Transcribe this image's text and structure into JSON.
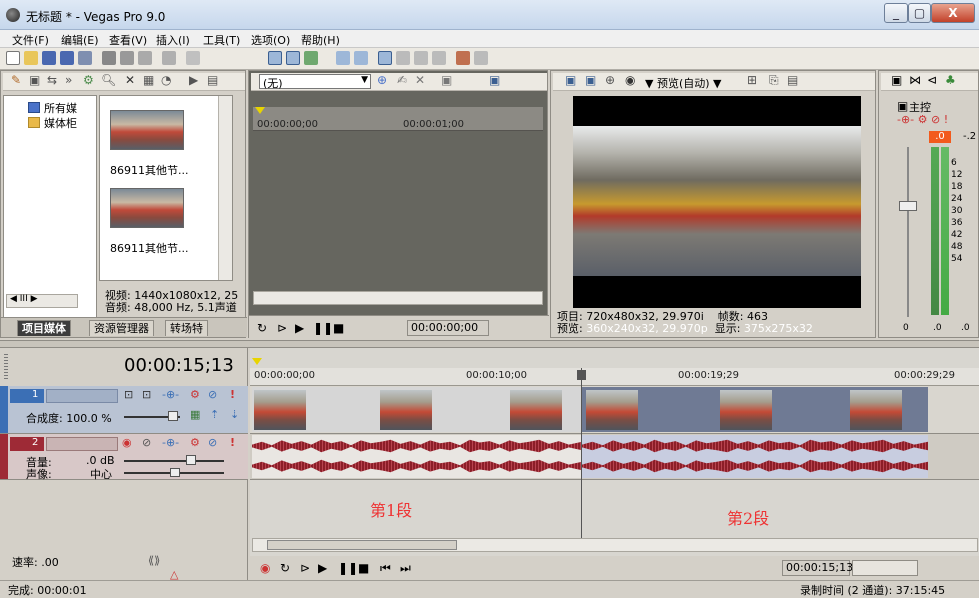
{
  "window": {
    "title": "无标题 * - Vegas Pro 9.0",
    "minimize": "_",
    "maximize": "▢",
    "close": "X"
  },
  "menu": [
    "文件(F)",
    "编辑(E)",
    "查看(V)",
    "插入(I)",
    "工具(T)",
    "选项(O)",
    "帮助(H)"
  ],
  "media": {
    "tree": [
      "所有媒",
      "媒体柜"
    ],
    "items": [
      {
        "caption": "86911其他节..."
      },
      {
        "caption": "86911其他节..."
      }
    ],
    "info_video": "视频: 1440x1080x12, 25",
    "info_audio": "音频: 48,000 Hz, 5.1声道",
    "tabs": [
      "项目媒体",
      "资源管理器",
      "转场特"
    ]
  },
  "trimmer": {
    "dropdown": "(无)",
    "ruler_start": "00:00:00;00",
    "ruler_mid": "00:00:01;00",
    "timecode": "00:00:00;00"
  },
  "preview": {
    "mode": "预览(自动)",
    "project": "项目: 720x480x32, 29.970i",
    "frame": "帧数: 463",
    "preview_label": "预览:",
    "preview_value": "360x240x32, 29.970p",
    "display_label": "显示:",
    "display_value": "375x275x32"
  },
  "mixer": {
    "label": "主控",
    "peak": ".0",
    "peak2": "-.2",
    "scale": [
      "6",
      "12",
      "18",
      "24",
      "30",
      "36",
      "42",
      "48",
      "54"
    ],
    "bottom": [
      ".0",
      ".0"
    ],
    "fader": "0"
  },
  "timeline": {
    "cursor_time": "00:00:15;13",
    "ruler": [
      "00:00:00;00",
      "00:00:10;00",
      "00:00:19;29",
      "00:00:29;29"
    ],
    "video_track": {
      "number": "1",
      "opacity_label": "合成度: 100.0 %"
    },
    "audio_track": {
      "number": "2",
      "volume_label": "音量:",
      "volume_value": ".0 dB",
      "pan_label": "声像:",
      "pan_value": "中心"
    },
    "segment1": "第1段",
    "segment2": "第2段",
    "rate": "速率: .00",
    "position": "00:00:15;13"
  },
  "status": {
    "left": "完成: 00:00:01",
    "right": "录制时间 (2 通道): 37:15:45"
  },
  "colors": {
    "segment_label": "#e33333",
    "clip_video": "#6f7a94",
    "waveform": "#8c1e28"
  }
}
